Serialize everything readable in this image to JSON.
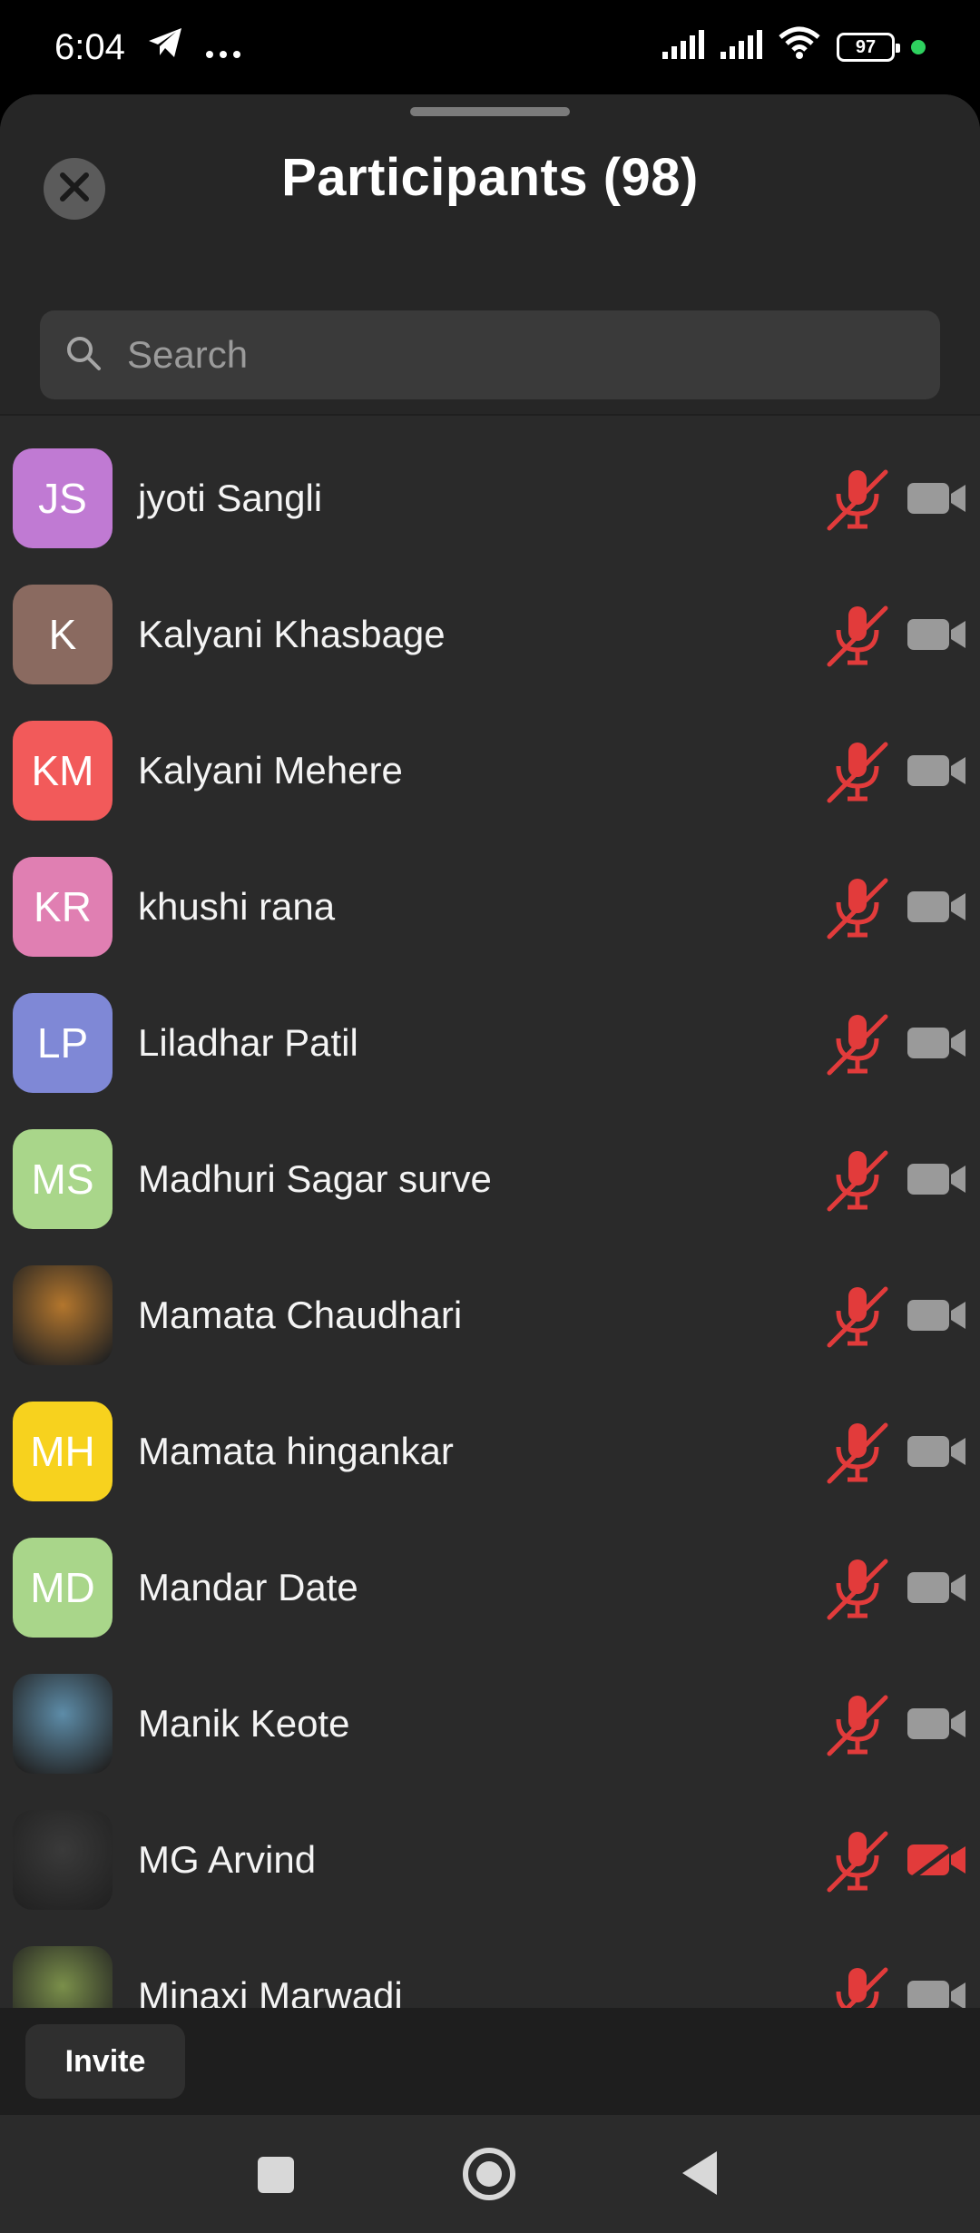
{
  "status_bar": {
    "time": "6:04",
    "battery": "97",
    "icons": [
      "telegram-icon",
      "more-dots-icon",
      "signal-icon",
      "signal-icon",
      "wifi-icon",
      "battery-icon"
    ]
  },
  "header": {
    "title": "Participants (98)",
    "close_icon": "close-icon"
  },
  "search": {
    "placeholder": "Search"
  },
  "participants": [
    {
      "initials": "JS",
      "name": "jyoti Sangli",
      "avatar_color": "#c07ad3",
      "mic": "muted",
      "video": "off"
    },
    {
      "initials": "K",
      "name": "Kalyani Khasbage",
      "avatar_color": "#8a6a60",
      "mic": "muted",
      "video": "off"
    },
    {
      "initials": "KM",
      "name": "Kalyani Mehere",
      "avatar_color": "#f25a5a",
      "mic": "muted",
      "video": "off"
    },
    {
      "initials": "KR",
      "name": "khushi rana",
      "avatar_color": "#e07fb2",
      "mic": "muted",
      "video": "off"
    },
    {
      "initials": "LP",
      "name": "Liladhar Patil",
      "avatar_color": "#7f88d6",
      "mic": "muted",
      "video": "off"
    },
    {
      "initials": "MS",
      "name": "Madhuri Sagar surve",
      "avatar_color": "#a9d68a",
      "mic": "muted",
      "video": "off"
    },
    {
      "initials": "",
      "name": "Mamata Chaudhari",
      "avatar_color": "#b3762d",
      "mic": "muted",
      "video": "off",
      "photo": true
    },
    {
      "initials": "MH",
      "name": "Mamata hingankar",
      "avatar_color": "#f7d21e",
      "mic": "muted",
      "video": "off"
    },
    {
      "initials": "MD",
      "name": "Mandar Date",
      "avatar_color": "#a9d68a",
      "mic": "muted",
      "video": "off"
    },
    {
      "initials": "",
      "name": "Manik Keote",
      "avatar_color": "#5d8ca8",
      "mic": "muted",
      "video": "off",
      "photo": true
    },
    {
      "initials": "",
      "name": "MG Arvind",
      "avatar_color": "#3a3a3a",
      "mic": "muted",
      "video": "off-red",
      "photo": true
    },
    {
      "initials": "",
      "name": "Minaxi Marwadi",
      "avatar_color": "#7a8f4a",
      "mic": "muted",
      "video": "off",
      "photo": true
    }
  ],
  "bottom": {
    "invite_label": "Invite"
  },
  "colors": {
    "muted_red": "#e23b3b",
    "video_gray": "#9a9a9a",
    "sheet_bg": "#2a2a2a"
  }
}
